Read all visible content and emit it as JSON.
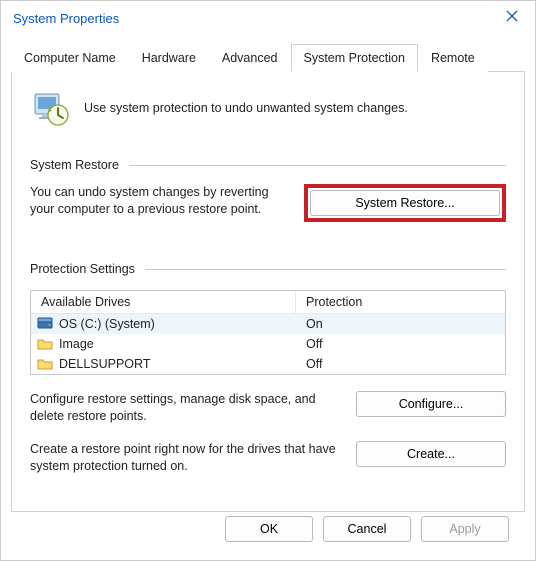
{
  "window": {
    "title": "System Properties"
  },
  "tabs": [
    "Computer Name",
    "Hardware",
    "Advanced",
    "System Protection",
    "Remote"
  ],
  "active_tab_index": 3,
  "intro": "Use system protection to undo unwanted system changes.",
  "sections": {
    "restore": {
      "title": "System Restore",
      "text": "You can undo system changes by reverting your computer to a previous restore point.",
      "button": "System Restore..."
    },
    "protection": {
      "title": "Protection Settings",
      "columns": [
        "Available Drives",
        "Protection"
      ],
      "drives": [
        {
          "icon": "disk",
          "name": "OS (C:) (System)",
          "protection": "On",
          "selected": true
        },
        {
          "icon": "folder",
          "name": "Image",
          "protection": "Off",
          "selected": false
        },
        {
          "icon": "folder",
          "name": "DELLSUPPORT",
          "protection": "Off",
          "selected": false
        }
      ],
      "configure_text": "Configure restore settings, manage disk space, and delete restore points.",
      "configure_button": "Configure...",
      "create_text": "Create a restore point right now for the drives that have system protection turned on.",
      "create_button": "Create..."
    }
  },
  "dialog_buttons": {
    "ok": "OK",
    "cancel": "Cancel",
    "apply": "Apply"
  }
}
